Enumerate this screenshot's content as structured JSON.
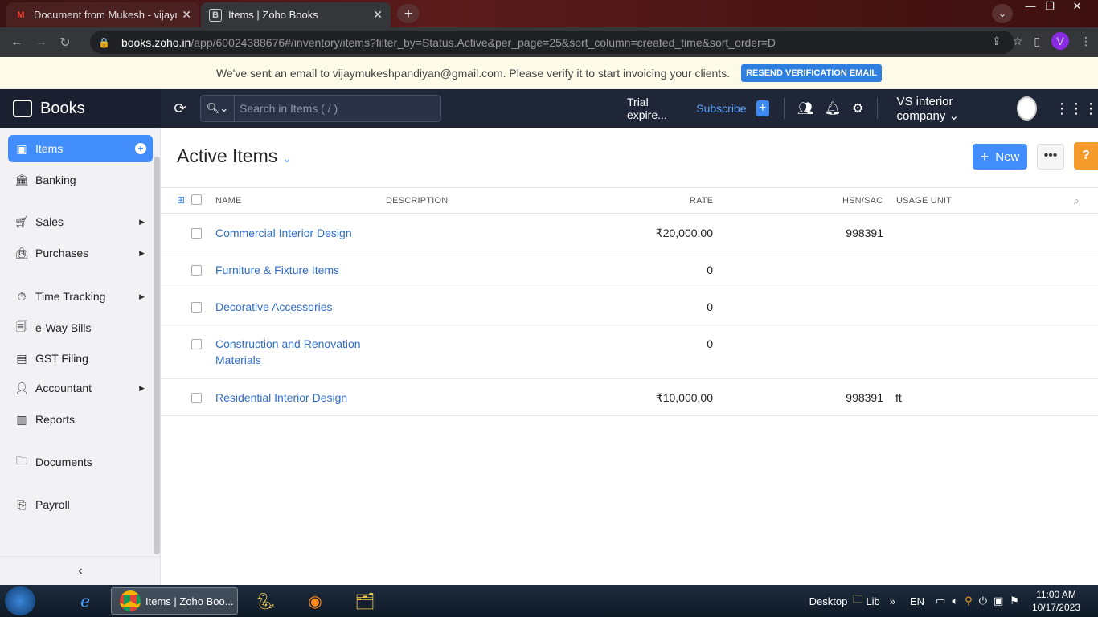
{
  "browser": {
    "tabs": [
      {
        "title": "Document from Mukesh - vijaymukesh",
        "favicon": "M",
        "active": false
      },
      {
        "title": "Items | Zoho Books",
        "favicon": "B",
        "active": true
      }
    ],
    "url_host": "books.zoho.in",
    "url_path": "/app/60024388676#/inventory/items?filter_by=Status.Active&per_page=25&sort_column=created_time&sort_order=D",
    "profile_initial": "V"
  },
  "banner": {
    "text": "We've sent an email to vijaymukeshpandiyan@gmail.com. Please verify it to start invoicing your clients.",
    "button": "RESEND VERIFICATION EMAIL"
  },
  "header": {
    "brand": "Books",
    "search_placeholder": "Search in Items ( / )",
    "trial": "Trial expire...",
    "subscribe": "Subscribe",
    "org": "VS interior company"
  },
  "sidebar": {
    "items": [
      {
        "label": "Items",
        "icon": "box-icon",
        "active": true
      },
      {
        "label": "Banking",
        "icon": "bank-icon"
      },
      {
        "label": "Sales",
        "icon": "cart-icon",
        "arrow": true
      },
      {
        "label": "Purchases",
        "icon": "bag-icon",
        "arrow": true
      },
      {
        "label": "Time Tracking",
        "icon": "clock-icon",
        "arrow": true
      },
      {
        "label": "e-Way Bills",
        "icon": "truck-icon"
      },
      {
        "label": "GST Filing",
        "icon": "gst-icon"
      },
      {
        "label": "Accountant",
        "icon": "person-icon",
        "arrow": true
      },
      {
        "label": "Reports",
        "icon": "chart-icon"
      },
      {
        "label": "Documents",
        "icon": "folder-icon"
      },
      {
        "label": "Payroll",
        "icon": "payroll-icon"
      }
    ]
  },
  "main": {
    "title": "Active Items",
    "new_label": "New",
    "help": "?",
    "columns": {
      "name": "NAME",
      "description": "DESCRIPTION",
      "rate": "RATE",
      "hsn": "HSN/SAC",
      "unit": "USAGE UNIT"
    },
    "rows": [
      {
        "name": "Commercial Interior Design",
        "rate": "₹20,000.00",
        "hsn": "998391",
        "unit": ""
      },
      {
        "name": "Furniture & Fixture Items",
        "rate": "0",
        "hsn": "",
        "unit": ""
      },
      {
        "name": "Decorative Accessories",
        "rate": "0",
        "hsn": "",
        "unit": ""
      },
      {
        "name": "Construction and Renovation Materials",
        "rate": "0",
        "hsn": "",
        "unit": ""
      },
      {
        "name": "Residential Interior Design",
        "rate": "₹10,000.00",
        "hsn": "998391",
        "unit": "ft"
      }
    ]
  },
  "taskbar": {
    "chrome_label": "Items | Zoho Boo...",
    "desktop": "Desktop",
    "lib": "Lib",
    "lang": "EN",
    "time": "11:00 AM",
    "date": "10/17/2023"
  }
}
